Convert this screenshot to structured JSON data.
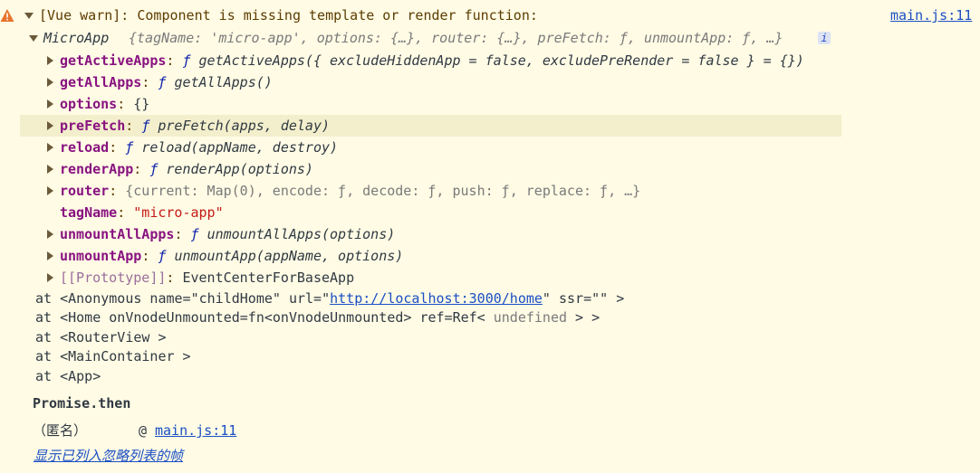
{
  "warning": {
    "text": "[Vue warn]: Component is missing template or render function:",
    "source": "main.js:11"
  },
  "object": {
    "name": "MicroApp",
    "summary": "{tagName: 'micro-app', options: {…}, router: {…}, preFetch: ƒ, unmountApp: ƒ,  …}",
    "info_badge": "i",
    "props": [
      {
        "key": "getActiveApps",
        "type": "ƒ",
        "value": "getActiveApps({ excludeHiddenApp = false, excludePreRender = false } = {})"
      },
      {
        "key": "getAllApps",
        "type": "ƒ",
        "value": "getAllApps()"
      },
      {
        "key": "options",
        "type": "",
        "value": "{}"
      },
      {
        "key": "preFetch",
        "type": "ƒ",
        "value": "preFetch(apps, delay)"
      },
      {
        "key": "reload",
        "type": "ƒ",
        "value": "reload(appName, destroy)"
      },
      {
        "key": "renderApp",
        "type": "ƒ",
        "value": "renderApp(options)"
      },
      {
        "key": "router",
        "type": "",
        "value": "{current: Map(0), encode: ƒ, decode: ƒ, push: ƒ, replace: ƒ,  …}"
      },
      {
        "key": "tagName",
        "type": "",
        "value": "\"micro-app\""
      },
      {
        "key": "unmountAllApps",
        "type": "ƒ",
        "value": "unmountAllApps(options)"
      },
      {
        "key": "unmountApp",
        "type": "ƒ",
        "value": "unmountApp(appName, options)"
      },
      {
        "key": "[[Prototype]]",
        "type": "",
        "value": "EventCenterForBaseApp"
      }
    ]
  },
  "trace": {
    "line1_pre": "at <Anonymous name=\"childHome\" url=\"",
    "line1_url": "http://localhost:3000/home",
    "line1_post": "\" ssr=\"\" >",
    "line2_pre": "at <Home onVnodeUnmounted=fn<onVnodeUnmounted> ref=Ref<",
    "line2_gray": " undefined ",
    "line2_post": "> >",
    "line3": "at <RouterView >",
    "line4": "at <MainContainer >",
    "line5": "at <App>"
  },
  "stack": {
    "promise": "Promise.then",
    "anon": "（匿名）",
    "at": "@",
    "link": "main.js:11",
    "ignored_frames": "显示已列入忽略列表的帧"
  },
  "colors": {
    "background": "#fffbe5",
    "warning_icon": "#e8732c",
    "key": "#881280",
    "string": "#c41a16",
    "link": "#1a4fc4"
  }
}
